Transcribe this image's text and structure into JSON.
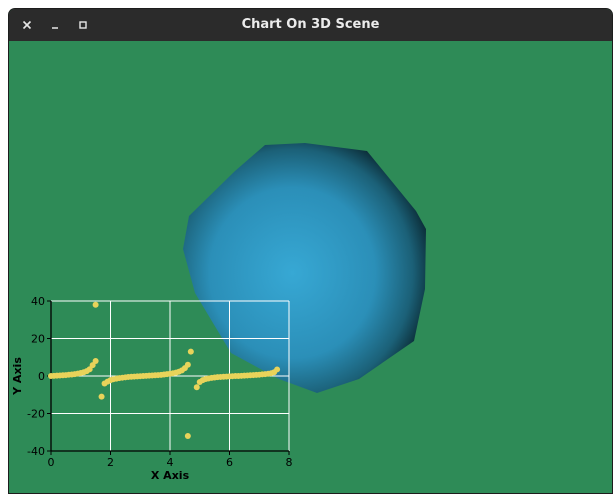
{
  "window": {
    "title": "Chart On 3D Scene",
    "controls": {
      "close": "close-icon",
      "minimize": "minimize-icon",
      "maximize": "maximize-icon"
    }
  },
  "scene": {
    "background_color": "#2e8b57",
    "object": "octagon-sphere",
    "object_color": "#3aa3cf"
  },
  "chart_data": {
    "type": "scatter",
    "xlabel": "X Axis",
    "ylabel": "Y Axis",
    "xlim": [
      0,
      8
    ],
    "ylim": [
      -40,
      40
    ],
    "x_ticks": [
      "0",
      "2",
      "4",
      "6",
      "8"
    ],
    "y_ticks": [
      "40",
      "20",
      "0",
      "-20",
      "-40"
    ],
    "grid": true,
    "series": [
      {
        "color": "#e8d35a",
        "points": [
          [
            0.0,
            0.0
          ],
          [
            0.1,
            0.1
          ],
          [
            0.2,
            0.2
          ],
          [
            0.3,
            0.3
          ],
          [
            0.4,
            0.4
          ],
          [
            0.5,
            0.5
          ],
          [
            0.6,
            0.7
          ],
          [
            0.7,
            0.8
          ],
          [
            0.8,
            1.0
          ],
          [
            0.9,
            1.3
          ],
          [
            1.0,
            1.6
          ],
          [
            1.1,
            2.0
          ],
          [
            1.2,
            2.6
          ],
          [
            1.3,
            3.6
          ],
          [
            1.4,
            5.8
          ],
          [
            1.5,
            8.0
          ],
          [
            1.5,
            38.0
          ],
          [
            1.7,
            -11.0
          ],
          [
            1.8,
            -4.0
          ],
          [
            1.9,
            -3.0
          ],
          [
            2.0,
            -2.2
          ],
          [
            2.1,
            -1.7
          ],
          [
            2.2,
            -1.4
          ],
          [
            2.3,
            -1.1
          ],
          [
            2.4,
            -0.9
          ],
          [
            2.5,
            -0.7
          ],
          [
            2.6,
            -0.5
          ],
          [
            2.7,
            -0.4
          ],
          [
            2.8,
            -0.3
          ],
          [
            2.9,
            -0.2
          ],
          [
            3.0,
            -0.1
          ],
          [
            3.1,
            0.0
          ],
          [
            3.2,
            0.1
          ],
          [
            3.3,
            0.2
          ],
          [
            3.4,
            0.3
          ],
          [
            3.5,
            0.4
          ],
          [
            3.6,
            0.5
          ],
          [
            3.7,
            0.6
          ],
          [
            3.8,
            0.8
          ],
          [
            3.9,
            1.0
          ],
          [
            4.0,
            1.2
          ],
          [
            4.1,
            1.5
          ],
          [
            4.2,
            1.8
          ],
          [
            4.3,
            2.3
          ],
          [
            4.4,
            3.0
          ],
          [
            4.5,
            4.2
          ],
          [
            4.6,
            6.0
          ],
          [
            4.7,
            13.0
          ],
          [
            4.6,
            -32.0
          ],
          [
            4.9,
            -6.0
          ],
          [
            5.0,
            -3.2
          ],
          [
            5.1,
            -2.2
          ],
          [
            5.2,
            -1.6
          ],
          [
            5.3,
            -1.3
          ],
          [
            5.4,
            -1.0
          ],
          [
            5.5,
            -0.8
          ],
          [
            5.6,
            -0.6
          ],
          [
            5.7,
            -0.5
          ],
          [
            5.8,
            -0.4
          ],
          [
            5.9,
            -0.3
          ],
          [
            6.0,
            -0.2
          ],
          [
            6.1,
            -0.1
          ],
          [
            6.2,
            0.0
          ],
          [
            6.3,
            0.0
          ],
          [
            6.4,
            0.1
          ],
          [
            6.5,
            0.2
          ],
          [
            6.6,
            0.3
          ],
          [
            6.7,
            0.4
          ],
          [
            6.8,
            0.5
          ],
          [
            6.9,
            0.6
          ],
          [
            7.0,
            0.7
          ],
          [
            7.1,
            0.9
          ],
          [
            7.2,
            1.0
          ],
          [
            7.3,
            1.2
          ],
          [
            7.4,
            1.5
          ],
          [
            7.5,
            2.0
          ],
          [
            7.6,
            3.5
          ]
        ]
      }
    ]
  }
}
